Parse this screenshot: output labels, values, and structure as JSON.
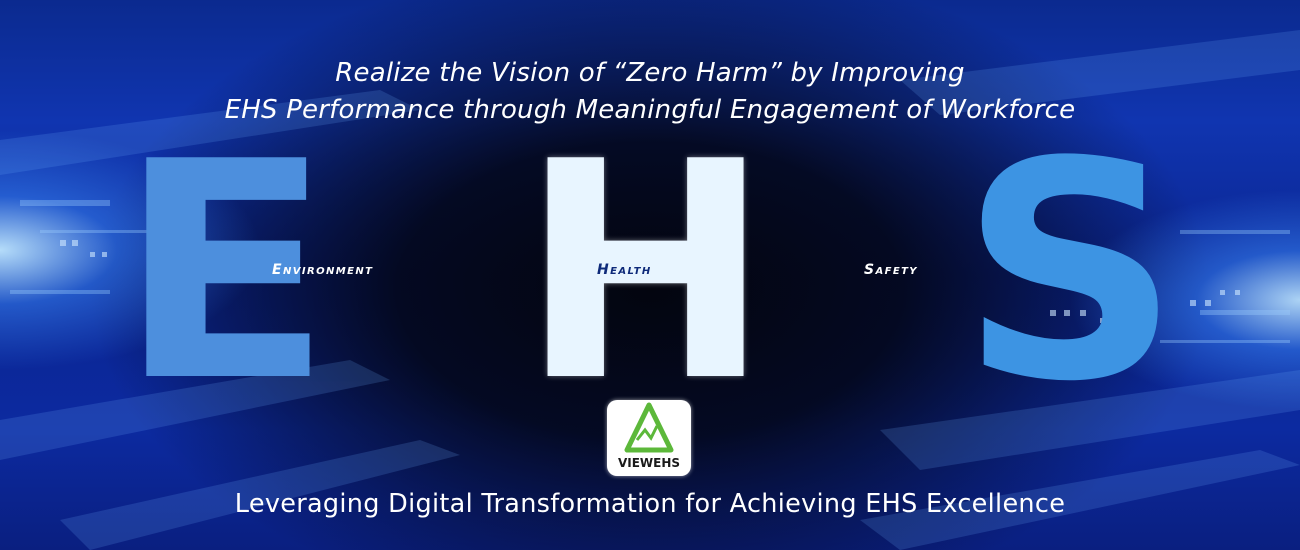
{
  "banner": {
    "tagline_line1": "Realize the Vision of  “Zero Harm”  by Improving",
    "tagline_line2": "EHS Performance  through Meaningful Engagement of Workforce",
    "letters": {
      "e": "E",
      "h": "H",
      "s": "S"
    },
    "words": {
      "environment": "Environment",
      "health": "Health",
      "safety": "Safety"
    },
    "bottom_line": "Leveraging Digital Transformation for Achieving EHS Excellence"
  },
  "logo": {
    "text": "VIEWEHS",
    "icon": "mountain-magnifier-icon"
  },
  "colors": {
    "background_blue": "#1035b0",
    "letter_e": "#4d8fdd",
    "letter_h": "#e8f5ff",
    "letter_s": "#3d94e3",
    "health_word": "#0e2a7a",
    "logo_green": "#5cb83a"
  }
}
